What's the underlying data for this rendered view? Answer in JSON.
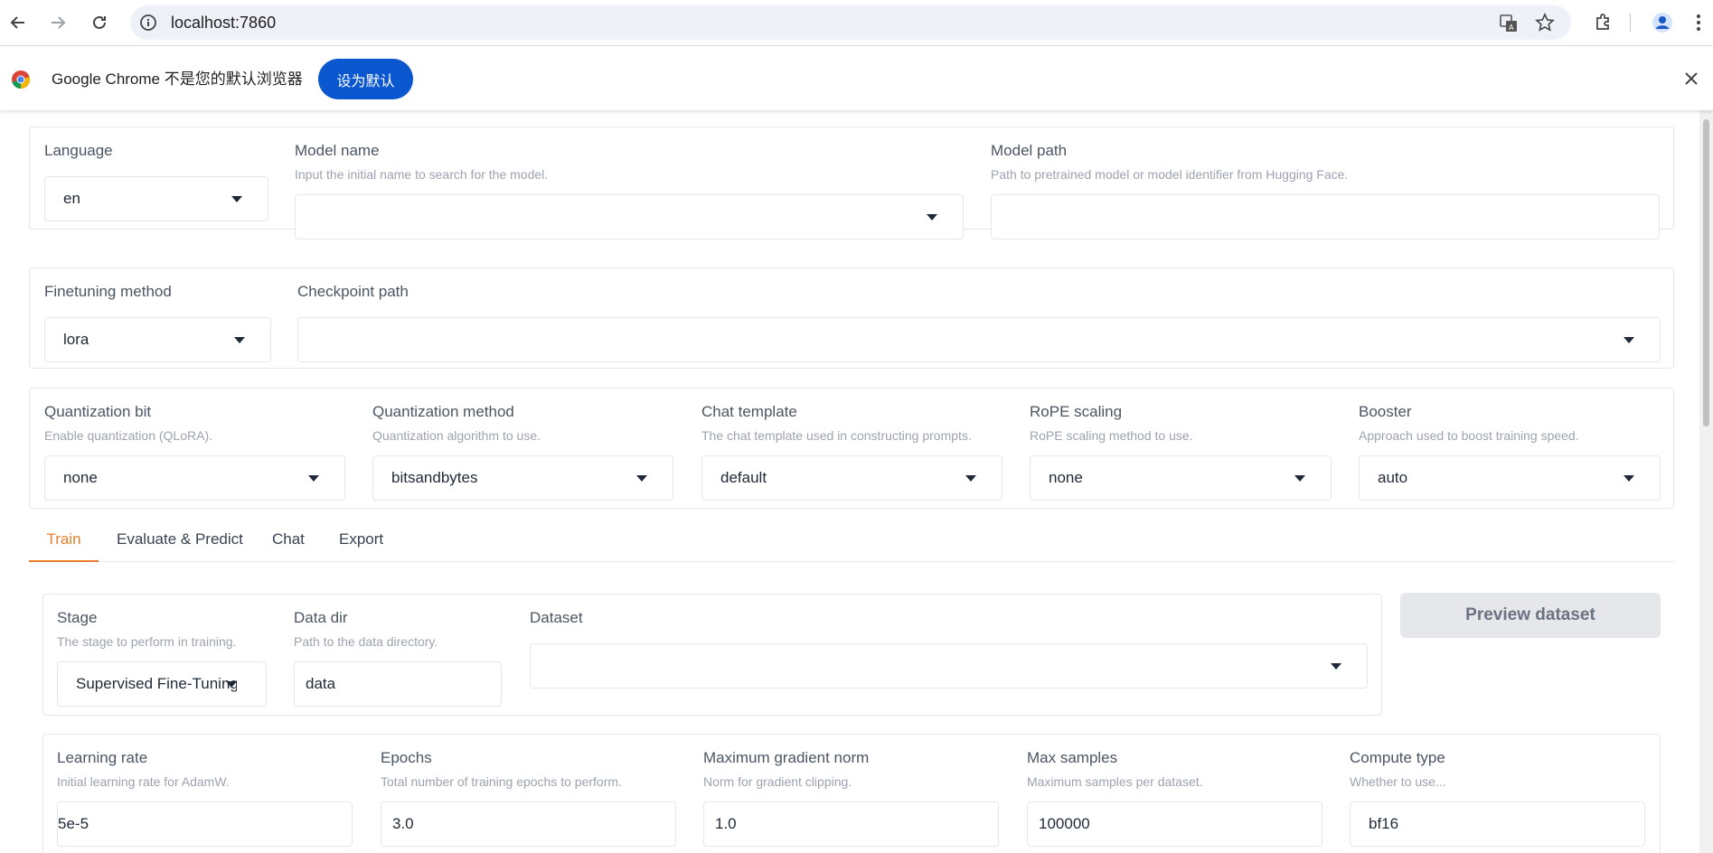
{
  "browser": {
    "url": "localhost:7860",
    "infobar_message": "Google Chrome 不是您的默认浏览器",
    "set_default_label": "设为默认"
  },
  "top": {
    "language": {
      "label": "Language",
      "value": "en"
    },
    "model_name": {
      "label": "Model name",
      "info": "Input the initial name to search for the model.",
      "value": ""
    },
    "model_path": {
      "label": "Model path",
      "info": "Path to pretrained model or model identifier from Hugging Face.",
      "value": ""
    }
  },
  "method": {
    "finetuning": {
      "label": "Finetuning method",
      "value": "lora"
    },
    "checkpoint": {
      "label": "Checkpoint path",
      "value": ""
    }
  },
  "advanced": {
    "quant_bit": {
      "label": "Quantization bit",
      "info": "Enable quantization (QLoRA).",
      "value": "none"
    },
    "quant_method": {
      "label": "Quantization method",
      "info": "Quantization algorithm to use.",
      "value": "bitsandbytes"
    },
    "chat_template": {
      "label": "Chat template",
      "info": "The chat template used in constructing prompts.",
      "value": "default"
    },
    "rope": {
      "label": "RoPE scaling",
      "info": "RoPE scaling method to use.",
      "value": "none"
    },
    "booster": {
      "label": "Booster",
      "info": "Approach used to boost training speed.",
      "value": "auto"
    }
  },
  "tabs": [
    "Train",
    "Evaluate & Predict",
    "Chat",
    "Export"
  ],
  "train": {
    "stage": {
      "label": "Stage",
      "info": "The stage to perform in training.",
      "value": "Supervised Fine-Tuning"
    },
    "data_dir": {
      "label": "Data dir",
      "info": "Path to the data directory.",
      "value": "data"
    },
    "dataset": {
      "label": "Dataset",
      "value": ""
    },
    "preview_label": "Preview dataset",
    "learning_rate": {
      "label": "Learning rate",
      "info": "Initial learning rate for AdamW.",
      "value": "5e-5"
    },
    "epochs": {
      "label": "Epochs",
      "info": "Total number of training epochs to perform.",
      "value": "3.0"
    },
    "max_grad_norm": {
      "label": "Maximum gradient norm",
      "info": "Norm for gradient clipping.",
      "value": "1.0"
    },
    "max_samples": {
      "label": "Max samples",
      "info": "Maximum samples per dataset.",
      "value": "100000"
    },
    "compute_type": {
      "label": "Compute type",
      "info": "Whether to use...",
      "value": "bf16"
    }
  }
}
